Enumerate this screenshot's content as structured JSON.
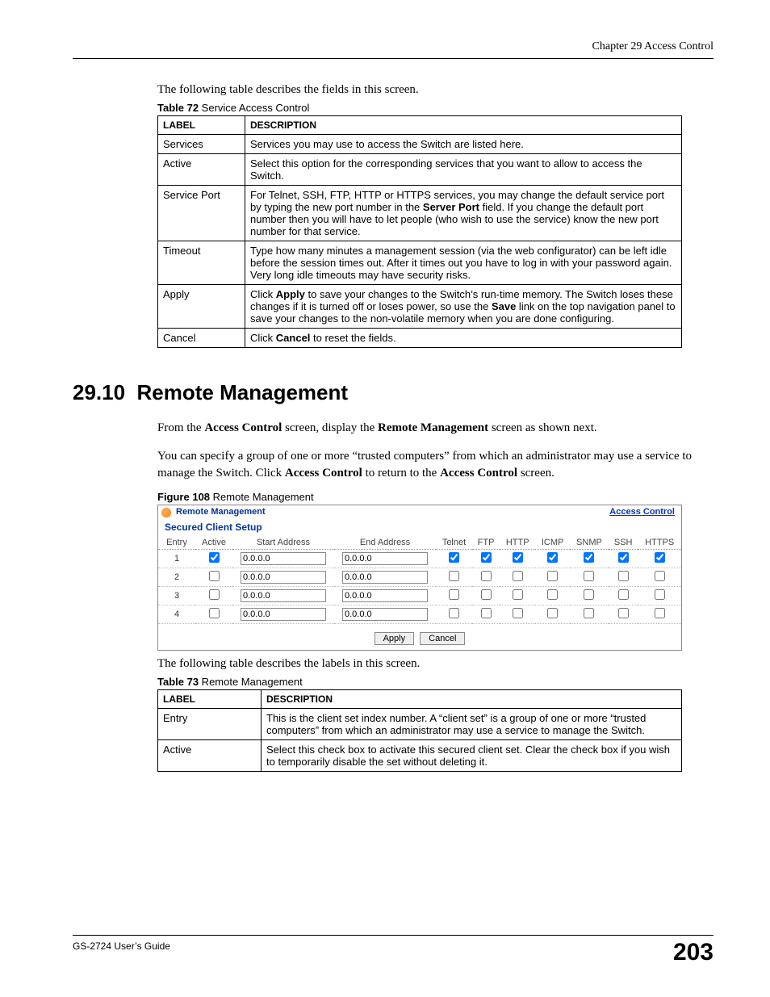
{
  "header": {
    "chapter": "Chapter 29 Access Control"
  },
  "intro1": "The following table describes the fields in this screen.",
  "table72": {
    "caption_bold": "Table 72",
    "caption_rest": "   Service Access Control",
    "col1": "LABEL",
    "col2": "DESCRIPTION",
    "rows": [
      {
        "label": "Services",
        "desc": "Services you may use to access the Switch are listed here."
      },
      {
        "label": "Active",
        "desc": "Select this option for the corresponding services that you want to allow to access the Switch."
      },
      {
        "label": "Service Port",
        "desc_pre": "For Telnet, SSH, FTP, HTTP or HTTPS services, you may change the default service port by typing the new port number in the ",
        "desc_bold": "Server Port",
        "desc_post": " field. If you change the default port number then you will have to let people (who wish to use the service) know the new port number for that service."
      },
      {
        "label": "Timeout",
        "desc": "Type how many minutes a management session (via the web configurator) can be left idle before the session times out. After it times out you have to log in with your password again. Very long idle timeouts may have security risks."
      },
      {
        "label": "Apply",
        "desc_pre": "Click ",
        "desc_bold": "Apply",
        "desc_mid": " to save your changes to the Switch’s run-time memory. The Switch loses these changes if it is turned off or loses power, so use the ",
        "desc_bold2": "Save",
        "desc_post": " link on the top navigation panel to save your changes to the non-volatile memory when you are done configuring."
      },
      {
        "label": "Cancel",
        "desc_pre": "Click ",
        "desc_bold": "Cancel",
        "desc_post": " to reset the fields."
      }
    ]
  },
  "section": {
    "num": "29.10",
    "title": "Remote Management"
  },
  "para1_pre": "From the ",
  "para1_b1": "Access Control",
  "para1_mid": " screen, display the ",
  "para1_b2": "Remote Management",
  "para1_post": " screen as shown next.",
  "para2_pre": "You can specify a group of one or more “trusted computers” from which an administrator may use a service to manage the Switch. Click ",
  "para2_b1": "Access Control",
  "para2_mid": " to return to the ",
  "para2_b2": "Access Control",
  "para2_post": " screen.",
  "figure": {
    "caption_bold": "Figure 108",
    "caption_rest": "   Remote Management",
    "tab": "Remote Management",
    "link": "Access Control",
    "sub": "Secured Client Setup",
    "cols": [
      "Entry",
      "Active",
      "Start Address",
      "End Address",
      "Telnet",
      "FTP",
      "HTTP",
      "ICMP",
      "SNMP",
      "SSH",
      "HTTPS"
    ],
    "rows": [
      {
        "entry": "1",
        "active": true,
        "start": "0.0.0.0",
        "end": "0.0.0.0",
        "checks": [
          true,
          true,
          true,
          true,
          true,
          true,
          true
        ]
      },
      {
        "entry": "2",
        "active": false,
        "start": "0.0.0.0",
        "end": "0.0.0.0",
        "checks": [
          false,
          false,
          false,
          false,
          false,
          false,
          false
        ]
      },
      {
        "entry": "3",
        "active": false,
        "start": "0.0.0.0",
        "end": "0.0.0.0",
        "checks": [
          false,
          false,
          false,
          false,
          false,
          false,
          false
        ]
      },
      {
        "entry": "4",
        "active": false,
        "start": "0.0.0.0",
        "end": "0.0.0.0",
        "checks": [
          false,
          false,
          false,
          false,
          false,
          false,
          false
        ]
      }
    ],
    "apply": "Apply",
    "cancel": "Cancel"
  },
  "intro2": "The following table describes the labels in this screen.",
  "table73": {
    "caption_bold": "Table 73",
    "caption_rest": "   Remote Management",
    "col1": "LABEL",
    "col2": "DESCRIPTION",
    "rows": [
      {
        "label": "Entry",
        "desc": "This is the client set index number. A “client set” is a group of one or more “trusted computers” from which an administrator may use a service to manage the Switch."
      },
      {
        "label": "Active",
        "desc": "Select this check box to activate this secured client set. Clear the check box if you wish to temporarily disable the set without deleting it."
      }
    ]
  },
  "footer": {
    "guide": "GS-2724 User’s Guide",
    "page": "203"
  }
}
